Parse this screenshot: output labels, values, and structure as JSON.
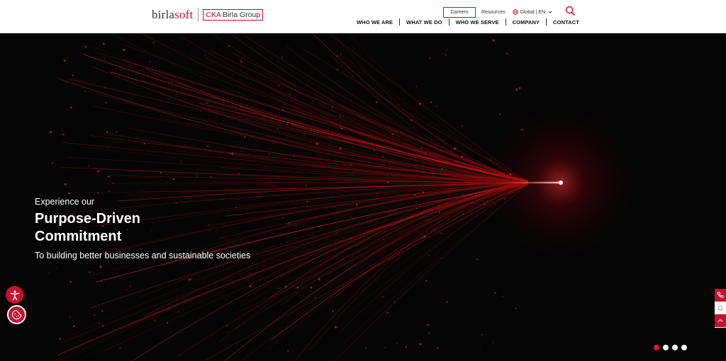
{
  "header": {
    "logo": {
      "brand_main": "birla",
      "brand_accent": "soft",
      "group_ck": "CKA",
      "group_name": "Birla Group"
    },
    "utility": {
      "careers": "Careers",
      "resources": "Resources",
      "region": "Global | EN"
    },
    "nav": [
      "WHO WE ARE",
      "WHAT WE DO",
      "WHO WE SERVE",
      "COMPANY",
      "CONTACT"
    ],
    "icons": {
      "search": "search-icon",
      "globe": "globe-icon",
      "chevron": "chevron-down-icon"
    }
  },
  "hero": {
    "eyebrow": "Experience our",
    "headline_line1": "Purpose-Driven",
    "headline_line2": "Commitment",
    "subtitle": "To building better businesses and sustainable societies",
    "carousel": {
      "total": 4,
      "active": 1
    }
  },
  "floating": {
    "accessibility": "accessibility-icon",
    "cookie": "cookie-icon",
    "rail": [
      "phone-icon",
      "bell-icon",
      "scroll-top-icon"
    ]
  },
  "colors": {
    "brand_red": "#c8102e",
    "hero_bg": "#050505",
    "dot_active": "#e0182d"
  }
}
